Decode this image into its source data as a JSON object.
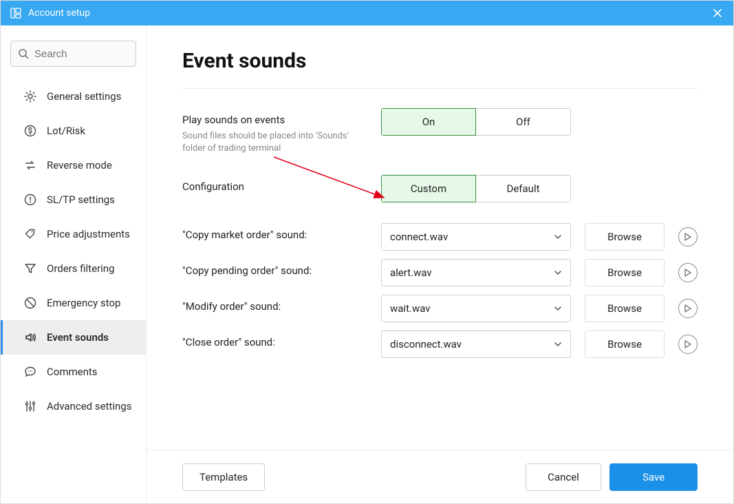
{
  "window": {
    "title": "Account setup"
  },
  "search": {
    "placeholder": "Search"
  },
  "sidebar": {
    "items": [
      {
        "label": "General settings"
      },
      {
        "label": "Lot/Risk"
      },
      {
        "label": "Reverse mode"
      },
      {
        "label": "SL/TP settings"
      },
      {
        "label": "Price adjustments"
      },
      {
        "label": "Orders filtering"
      },
      {
        "label": "Emergency stop"
      },
      {
        "label": "Event sounds"
      },
      {
        "label": "Comments"
      },
      {
        "label": "Advanced settings"
      }
    ]
  },
  "page": {
    "title": "Event sounds"
  },
  "play_sounds": {
    "label": "Play sounds on events",
    "hint": "Sound files should be placed into 'Sounds' folder of trading terminal",
    "on": "On",
    "off": "Off",
    "value": "On"
  },
  "configuration": {
    "label": "Configuration",
    "custom": "Custom",
    "default": "Default",
    "value": "Custom"
  },
  "sounds": [
    {
      "label": "\"Copy market order\" sound:",
      "value": "connect.wav",
      "browse": "Browse"
    },
    {
      "label": "\"Copy pending order\" sound:",
      "value": "alert.wav",
      "browse": "Browse"
    },
    {
      "label": "\"Modify order\" sound:",
      "value": "wait.wav",
      "browse": "Browse"
    },
    {
      "label": "\"Close order\" sound:",
      "value": "disconnect.wav",
      "browse": "Browse"
    }
  ],
  "footer": {
    "templates": "Templates",
    "cancel": "Cancel",
    "save": "Save"
  }
}
